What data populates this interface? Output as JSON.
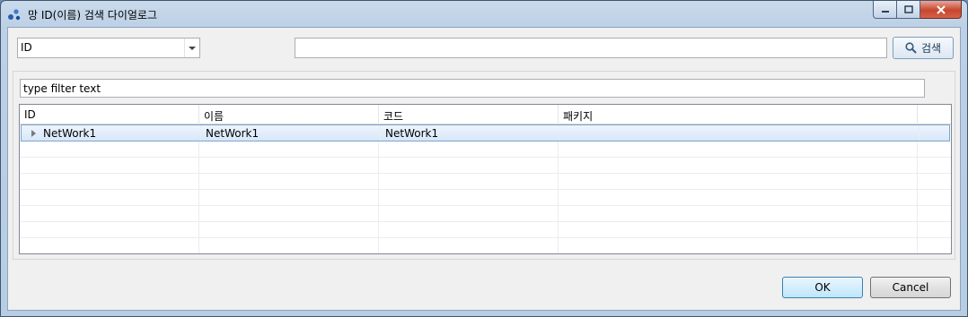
{
  "window": {
    "title": "망 ID(이름) 검색 다이얼로그"
  },
  "search": {
    "field_selected": "ID",
    "query_value": "",
    "button_label": "검색"
  },
  "filter": {
    "placeholder": "type filter text"
  },
  "table": {
    "columns": [
      "ID",
      "이름",
      "코드",
      "패키지"
    ],
    "rows": [
      {
        "id": "NetWork1",
        "name": "NetWork1",
        "code": "NetWork1",
        "package": ""
      }
    ]
  },
  "actions": {
    "ok_label": "OK",
    "cancel_label": "Cancel"
  },
  "colors": {
    "title_bar": "#bcd0e6",
    "selection": "#d7e7fa",
    "close_button": "#c7462c"
  }
}
